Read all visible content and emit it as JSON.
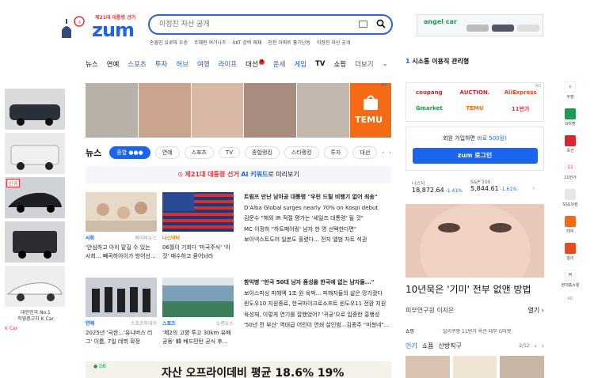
{
  "header": {
    "election_label": "제21대 대통령 선거",
    "logo": "zum",
    "search_placeholder": "이정진 자산 공개",
    "trending": [
      "손흥민 유로파 우승",
      "조혜련 여기나츠",
      "SKT 강력 제재",
      "인천 아파트 흉기난동",
      "이정진 자산 공개"
    ]
  },
  "top_ad": {
    "brand": "angel car"
  },
  "nav": {
    "items": [
      "뉴스",
      "연예",
      "스포츠",
      "투자",
      "허브",
      "여행",
      "라이프",
      "대선",
      "운세",
      "게임",
      "TV",
      "쇼핑"
    ],
    "more": "더보기"
  },
  "ticker": {
    "rank": "1",
    "text": "시소통 이용직 관리형"
  },
  "left_ads": {
    "caption_line1": "대한민국 No.1",
    "caption_line2": "직영중고차 K Car",
    "footer": "K Car",
    "tag": "신규"
  },
  "news_section": {
    "title": "뉴스",
    "tabs": [
      "종합",
      "연예",
      "스포츠",
      "TV",
      "종합랭킹",
      "스타랭킹",
      "투자",
      "대선"
    ],
    "election_banner": {
      "prefix": "제21대 대통령 선거",
      "ai": "AI 키워드",
      "suffix": "로 미리보기"
    },
    "cards": [
      {
        "cat": "사회",
        "src": "베이비뉴스",
        "title": "'안심하고 아이 맡길 수 있는 사회... 빼곡하아이가 방어선..."
      },
      {
        "cat": "나스닥터",
        "src": "",
        "title": "06월이 기회다 '미국주식' '이것' 매수하고 묻어놔라"
      },
      {
        "cat": "연예",
        "src": "스포츠투데이",
        "title": "2025년 '극한...'유니버스 리그' 이름, 7일 데뷔 확정"
      },
      {
        "cat": "스포츠",
        "src": "뉴젠뉴스",
        "title": "'제2의 고향 투고 30km 유배 공동' 韓 배드민턴 공식 후..."
      }
    ],
    "headlines1": [
      "트럼프 만난 남아공 대통령 \"우린 드릴 비행기 없어 죄송\"",
      "D'Alba Global surges nearly 70% on Kospi debut",
      "김문수 \"해외 IR 적절 평가는 '세일즈 대통령' 될 것\"",
      "MC 이정하 \"하트페어링' 남자 한 명 선택한다면\"",
      "보이넥스트도어 일본도 홀렸다... 전지 앨범 차트 석권"
    ],
    "headlines2": [
      "함익병 \"한국 50대 남자 품성을 한국에 없는 남자들...\"",
      "보이스피싱 피해액 1조 원 육박... 피해자들의 삶은 망가졌다",
      "윈도우10 지원종료, 한국마이크로소프트 윈도우11 전환 지원",
      "육성재, 이렇게 연기를 잘했었어? '귀궁'으로 입증한 흥행성",
      "'50년 전 부산' 역대급 어린이 연쇄 살인범...김종주 \"미쳤네\"..."
    ],
    "bottom_ad": "자산 오프라이데비 평균 18.6% 19%"
  },
  "banner_ad": {
    "brand": "TEMU",
    "ad_label": "AD"
  },
  "shopping_box": {
    "items": [
      "coupang",
      "AUCTION.",
      "AliExpress",
      "Gmarket",
      "TEMU",
      "11번가"
    ],
    "ad": "AD"
  },
  "login_box": {
    "promo": "회원 가입하면",
    "promo_highlight": "바로 500원!",
    "button": "zum 로그인"
  },
  "stocks": [
    {
      "name": "나스닥",
      "value": "18,872.64",
      "change": "-1.41%"
    },
    {
      "name": "S&P 500",
      "value": "5,844.61",
      "change": "-1.61%"
    }
  ],
  "right_ad": {
    "headline": "10년묵은 '기미' 전부 없앤 방법",
    "source": "피부연구원 이지은",
    "more": "열기"
  },
  "shopping": {
    "title": "쇼핑",
    "promo": "알리쿠팡 11번가 옥션 테무 G마켓",
    "tabs": [
      "인기",
      "쇼퓸",
      "산방직구"
    ],
    "page": "2/12"
  },
  "right_rail": {
    "items": [
      "쿠팡",
      "G마켓",
      "옥션",
      "11번가",
      "SSG닷컴",
      "테무",
      "알리",
      "현대홈쇼핑"
    ],
    "ad": "AD"
  },
  "colors": {
    "brand": "#1a64f0",
    "accent": "#e33"
  }
}
